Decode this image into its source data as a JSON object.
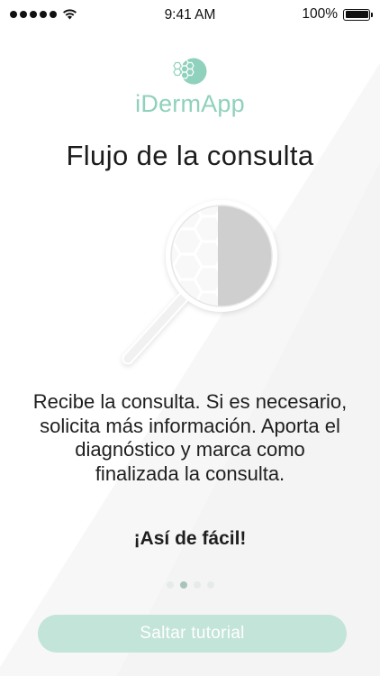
{
  "status_bar": {
    "time": "9:41 AM",
    "battery": "100%"
  },
  "logo": {
    "name": "iDermApp"
  },
  "onboarding": {
    "title": "Flujo de la consulta",
    "description": "Recibe la consulta. Si es necesario, solicita más información. Aporta el diagnóstico y marca como finalizada la consulta.",
    "emphasis": "¡Así de fácil!",
    "current_page": 2,
    "total_pages": 4
  },
  "skip_button": {
    "label": "Saltar tutorial"
  },
  "icons": {
    "illustration": "magnifier-skin-cells-icon",
    "logo": "idermapp-logo-icon",
    "signal": "signal-icon",
    "wifi": "wifi-icon",
    "battery": "battery-icon"
  },
  "colors": {
    "brand": "#8fd1bd",
    "button": "#c3e4d8",
    "button_text": "#ffffff",
    "dot_active": "#a8c4ba",
    "dot_inactive": "#e4ebe8"
  }
}
